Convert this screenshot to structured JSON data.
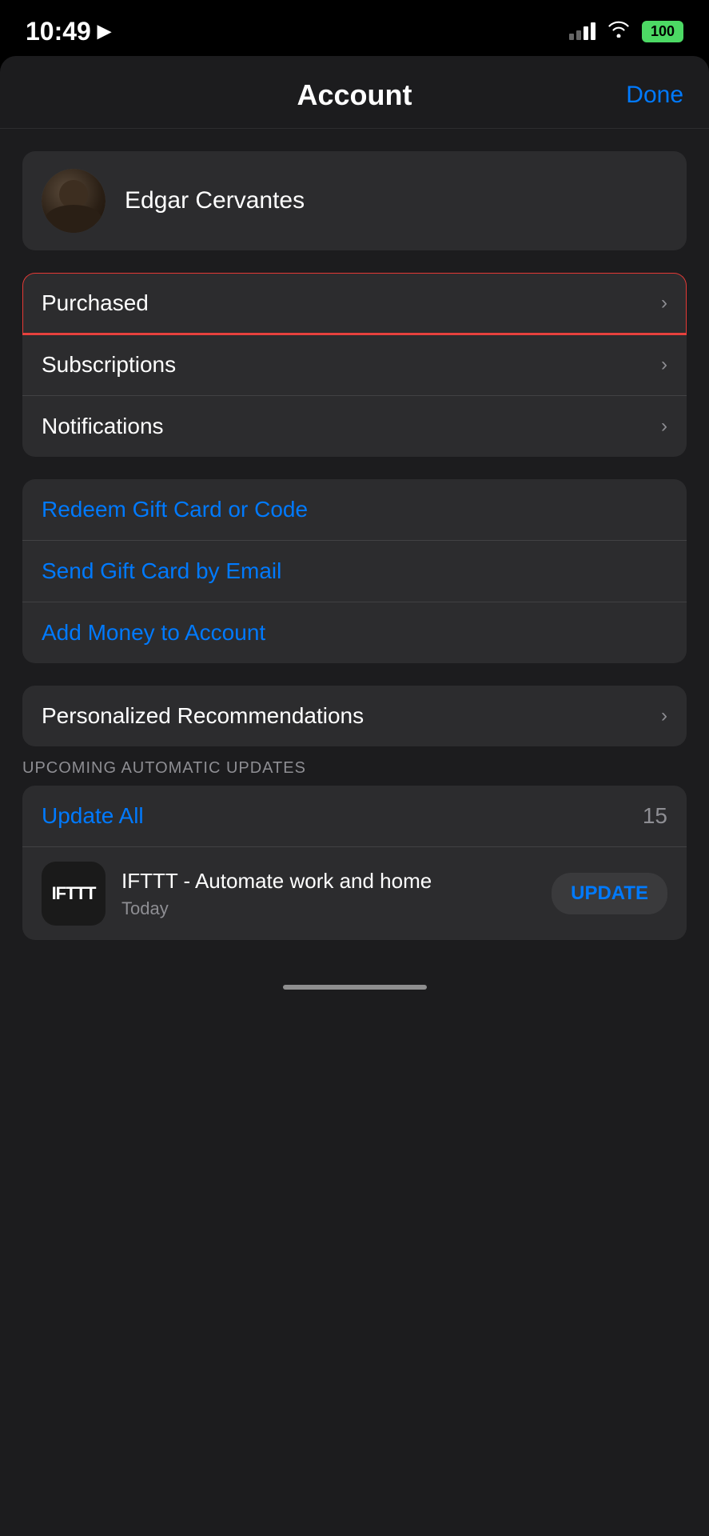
{
  "statusBar": {
    "time": "10:49",
    "battery": "100"
  },
  "navBar": {
    "title": "Account",
    "doneLabel": "Done"
  },
  "profile": {
    "name": "Edgar Cervantes"
  },
  "menuItems": [
    {
      "id": "purchased",
      "label": "Purchased",
      "hasChevron": true,
      "highlighted": true
    },
    {
      "id": "subscriptions",
      "label": "Subscriptions",
      "hasChevron": true
    },
    {
      "id": "notifications",
      "label": "Notifications",
      "hasChevron": true
    }
  ],
  "giftItems": [
    {
      "id": "redeem",
      "label": "Redeem Gift Card or Code"
    },
    {
      "id": "send-gift",
      "label": "Send Gift Card by Email"
    },
    {
      "id": "add-money",
      "label": "Add Money to Account"
    }
  ],
  "recommendations": {
    "label": "Personalized Recommendations",
    "hasChevron": true
  },
  "updatesSection": {
    "sectionLabel": "UPCOMING AUTOMATIC UPDATES",
    "updateAllLabel": "Update All",
    "updateCount": "15",
    "app": {
      "name": "IFTTT - Automate work and home",
      "date": "Today",
      "iconText": "IFTTT",
      "updateLabel": "UPDATE"
    }
  }
}
